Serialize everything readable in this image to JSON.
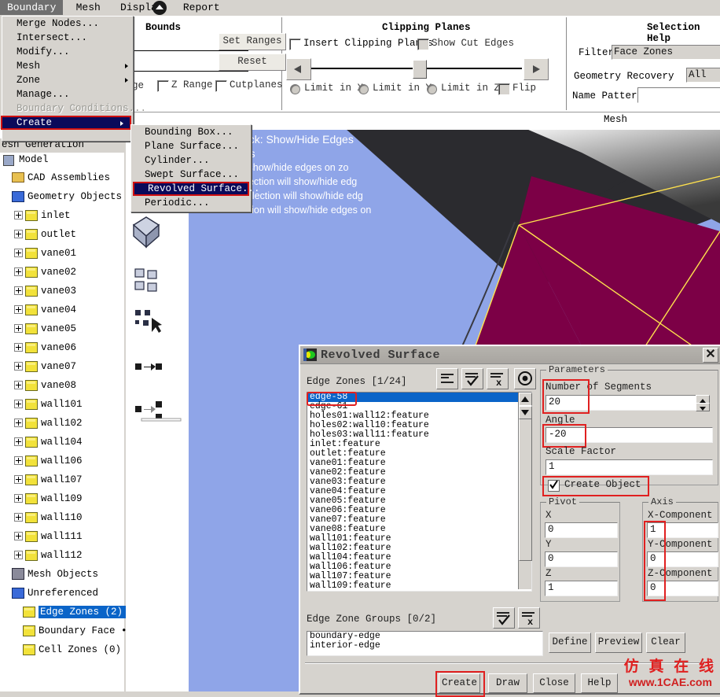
{
  "menubar": {
    "items": [
      "Boundary",
      "Mesh",
      "Display",
      "Report"
    ],
    "active": "Boundary",
    "collapse_icon": "chevron-up-circle-icon"
  },
  "boundary_menu": {
    "items": [
      {
        "label": "Merge Nodes...",
        "submenu": false,
        "disabled": false
      },
      {
        "label": "Intersect...",
        "submenu": false,
        "disabled": false
      },
      {
        "label": "Modify...",
        "submenu": false,
        "disabled": false
      },
      {
        "label": "Mesh",
        "submenu": true,
        "disabled": false
      },
      {
        "label": "Zone",
        "submenu": true,
        "disabled": false
      },
      {
        "label": "Manage...",
        "submenu": false,
        "disabled": false
      },
      {
        "label": "Boundary Conditions...",
        "submenu": false,
        "disabled": true
      }
    ],
    "highlighted": {
      "label": "Create",
      "submenu": true
    }
  },
  "create_submenu": {
    "items": [
      {
        "label": "Bounding Box...",
        "highlighted": false
      },
      {
        "label": "Plane Surface...",
        "highlighted": false
      },
      {
        "label": "Cylinder...",
        "highlighted": false
      },
      {
        "label": "Swept Surface...",
        "highlighted": false
      },
      {
        "label": "Revolved Surface...",
        "highlighted": true
      },
      {
        "label": "Periodic...",
        "highlighted": false
      }
    ]
  },
  "bounds_panel": {
    "title": "Bounds",
    "set_ranges": "Set Ranges",
    "reset": "Reset",
    "z_range": "Z Range",
    "cutplanes": "Cutplanes",
    "x_range_partial": "ge",
    "field1": "",
    "field2": ""
  },
  "clipping_panel": {
    "title": "Clipping Planes",
    "insert_clipping_planes": "Insert Clipping Planes",
    "show_cut_edges": "Show Cut Edges",
    "limit_in_x": "Limit in X",
    "limit_in_y": "Limit in Y",
    "limit_in_z": "Limit in Z",
    "flip": "Flip",
    "slider_percent": 50
  },
  "selection_panel": {
    "title": "Selection Help",
    "filter_label": "Filter",
    "filter_value": "Face Zones",
    "geometry_recovery_label": "Geometry Recovery",
    "geometry_recovery_value": "All",
    "name_pattern_label": "Name Pattern",
    "name_pattern_value": ""
  },
  "mesh_tab": {
    "label": "Mesh"
  },
  "tree": {
    "header": "esh Generation",
    "root": "Model",
    "nodes": [
      {
        "label": "CAD Assemblies",
        "icon": "cad-folder-icon",
        "indent": 1,
        "expand": false
      },
      {
        "label": "Geometry Objects",
        "icon": "blue-cube-icon",
        "indent": 1,
        "expand": false
      },
      {
        "label": "inlet",
        "icon": "yellow-box-icon",
        "indent": 2,
        "expand": true
      },
      {
        "label": "outlet",
        "icon": "yellow-box-icon",
        "indent": 2,
        "expand": true
      },
      {
        "label": "vane01",
        "icon": "yellow-box-icon",
        "indent": 2,
        "expand": true
      },
      {
        "label": "vane02",
        "icon": "yellow-box-icon",
        "indent": 2,
        "expand": true
      },
      {
        "label": "vane03",
        "icon": "yellow-box-icon",
        "indent": 2,
        "expand": true
      },
      {
        "label": "vane04",
        "icon": "yellow-box-icon",
        "indent": 2,
        "expand": true
      },
      {
        "label": "vane05",
        "icon": "yellow-box-icon",
        "indent": 2,
        "expand": true
      },
      {
        "label": "vane06",
        "icon": "yellow-box-icon",
        "indent": 2,
        "expand": true
      },
      {
        "label": "vane07",
        "icon": "yellow-box-icon",
        "indent": 2,
        "expand": true
      },
      {
        "label": "vane08",
        "icon": "yellow-box-icon",
        "indent": 2,
        "expand": true
      },
      {
        "label": "wall101",
        "icon": "yellow-box-icon",
        "indent": 2,
        "expand": true
      },
      {
        "label": "wall102",
        "icon": "yellow-box-icon",
        "indent": 2,
        "expand": true
      },
      {
        "label": "wall104",
        "icon": "yellow-box-icon",
        "indent": 2,
        "expand": true
      },
      {
        "label": "wall106",
        "icon": "yellow-box-icon",
        "indent": 2,
        "expand": true
      },
      {
        "label": "wall107",
        "icon": "yellow-box-icon",
        "indent": 2,
        "expand": true
      },
      {
        "label": "wall109",
        "icon": "yellow-box-icon",
        "indent": 2,
        "expand": true
      },
      {
        "label": "wall110",
        "icon": "yellow-box-icon",
        "indent": 2,
        "expand": true
      },
      {
        "label": "wall111",
        "icon": "yellow-box-icon",
        "indent": 2,
        "expand": true
      },
      {
        "label": "wall112",
        "icon": "yellow-box-icon",
        "indent": 2,
        "expand": true
      },
      {
        "label": "Mesh Objects",
        "icon": "mesh-cube-icon",
        "indent": 1,
        "expand": false
      },
      {
        "label": "Unreferenced",
        "icon": "blue-square-icon",
        "indent": 1,
        "expand": false
      },
      {
        "label": "Edge Zones (2)",
        "icon": "yellow-square-icon",
        "indent": 2,
        "expand": false,
        "selected": true
      },
      {
        "label": "Boundary Face •••",
        "icon": "yellow-square-icon",
        "indent": 2,
        "expand": false
      },
      {
        "label": "Cell Zones (0)",
        "icon": "yellow-square-icon",
        "indent": 2,
        "expand": false
      }
    ]
  },
  "toolbar_icons": [
    {
      "name": "measure-angle-icon"
    },
    {
      "name": "plane-surface-icon"
    },
    {
      "name": "bounding-box-icon"
    },
    {
      "name": "multi-object-icon"
    },
    {
      "name": "select-zones-icon"
    },
    {
      "name": "merge-zones-icon"
    },
    {
      "name": "split-zones-icon"
    }
  ],
  "viewport": {
    "tooltip": {
      "line1": "Ctrl right-click: Show/Hide Edges",
      "line2": "Show Edges",
      "line3": "Use this to show/hide edges on zo",
      "line4": "Zone selection will show/hide edg",
      "line5": "Object selection will show/hide edg",
      "line6": "No selection will show/hide edges on"
    },
    "colors": {
      "background": "#8fa5e8",
      "dark_gray": "#2e2e32",
      "magenta": "#c1007c",
      "dark_magenta": "#7a0045",
      "edge_yellow": "#ffe14d",
      "arrow_red": "#e02020"
    }
  },
  "dialog": {
    "title": "Revolved Surface",
    "close_label": "✕",
    "edge_zones_label": "Edge Zones [1/24]",
    "toolbar_icons": [
      {
        "name": "list-deselect-icon"
      },
      {
        "name": "list-select-all-icon"
      },
      {
        "name": "list-clear-all-icon"
      },
      {
        "name": "list-highlight-icon"
      }
    ],
    "edge_zone_items": [
      "edge-58",
      "edge-61",
      "holes01:wall12:feature",
      "holes02:wall10:feature",
      "holes03:wall11:feature",
      "inlet:feature",
      "outlet:feature",
      "vane01:feature",
      "vane02:feature",
      "vane03:feature",
      "vane04:feature",
      "vane05:feature",
      "vane06:feature",
      "vane07:feature",
      "vane08:feature",
      "wall101:feature",
      "wall102:feature",
      "wall104:feature",
      "wall106:feature",
      "wall107:feature",
      "wall109:feature"
    ],
    "selected_edge_zone": "edge-58",
    "parameters": {
      "group_label": "Parameters",
      "number_of_segments_label": "Number of Segments",
      "number_of_segments_value": "20",
      "angle_label": "Angle",
      "angle_value": "-20",
      "scale_factor_label": "Scale Factor",
      "scale_factor_value": "1",
      "create_object_label": "Create Object",
      "create_object_checked": true
    },
    "pivot": {
      "group_label": "Pivot",
      "x_label": "X",
      "x_value": "0",
      "y_label": "Y",
      "y_value": "0",
      "z_label": "Z",
      "z_value": "1"
    },
    "axis": {
      "group_label": "Axis",
      "x_label": "X-Component",
      "x_value": "1",
      "y_label": "Y-Component",
      "y_value": "0",
      "z_label": "Z-Component",
      "z_value": "0"
    },
    "edge_zone_groups_label": "Edge Zone Groups [0/2]",
    "edge_zone_groups_icons": [
      {
        "name": "group-select-all-icon"
      },
      {
        "name": "group-clear-all-icon"
      }
    ],
    "edge_zone_group_items": [
      "boundary-edge",
      "interior-edge"
    ],
    "side_buttons": [
      "Define",
      "Preview",
      "Clear"
    ],
    "bottom_buttons": [
      {
        "label": "Create",
        "highlighted": true
      },
      {
        "label": "Draw",
        "highlighted": false
      },
      {
        "label": "Close",
        "highlighted": false
      },
      {
        "label": "Help",
        "highlighted": false
      }
    ]
  },
  "watermark": {
    "chinese": "仿 真 在 线",
    "url": "www.1CAE.com",
    "big": "1CAE.COM"
  }
}
